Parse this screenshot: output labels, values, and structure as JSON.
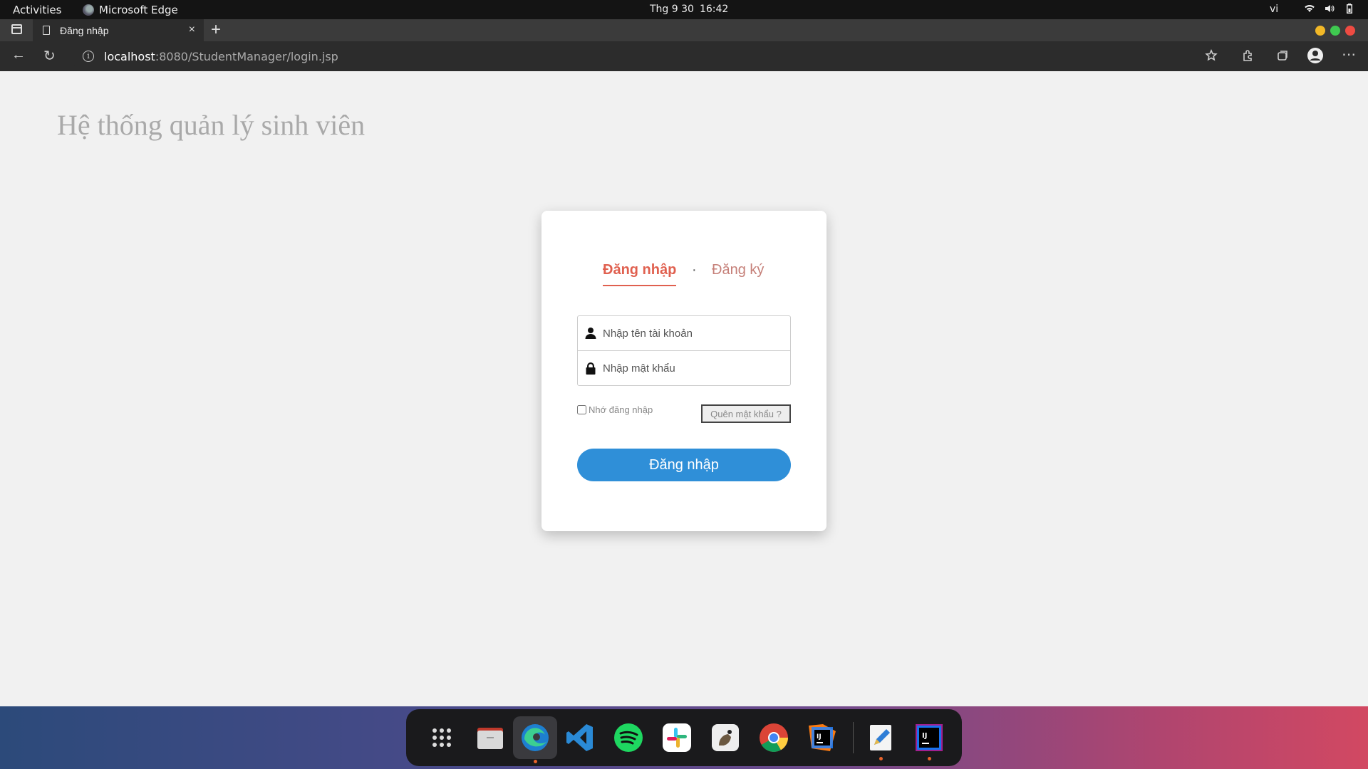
{
  "system_bar": {
    "activities": "Activities",
    "app_name": "Microsoft Edge",
    "date": "Thg 9 30",
    "time": "16:42",
    "language": "vi"
  },
  "browser": {
    "tab_title": "Đăng nhập",
    "url_host": "localhost",
    "url_rest": ":8080/StudentManager/login.jsp"
  },
  "page": {
    "heading": "Hệ thống quản lý sinh viên",
    "tabs": {
      "login": "Đăng nhập",
      "separator": "·",
      "register": "Đăng ký"
    },
    "username_placeholder": "Nhập tên tài khoản",
    "password_placeholder": "Nhập mật khẩu",
    "remember_label": "Nhớ đăng nhập",
    "forgot_label": "Quên mật khẩu ?",
    "submit_label": "Đăng nhập"
  },
  "colors": {
    "accent_tab": "#e0604f",
    "button": "#2f8fd8",
    "heading": "#a9a9a9"
  },
  "dock": {
    "items": [
      "apps-grid-icon",
      "files-icon",
      "edge-icon",
      "vscode-icon",
      "spotify-icon",
      "slack-icon",
      "gimp-icon",
      "chrome-icon",
      "jetbrains-toolbox-icon",
      "text-editor-icon",
      "intellij-icon"
    ]
  }
}
